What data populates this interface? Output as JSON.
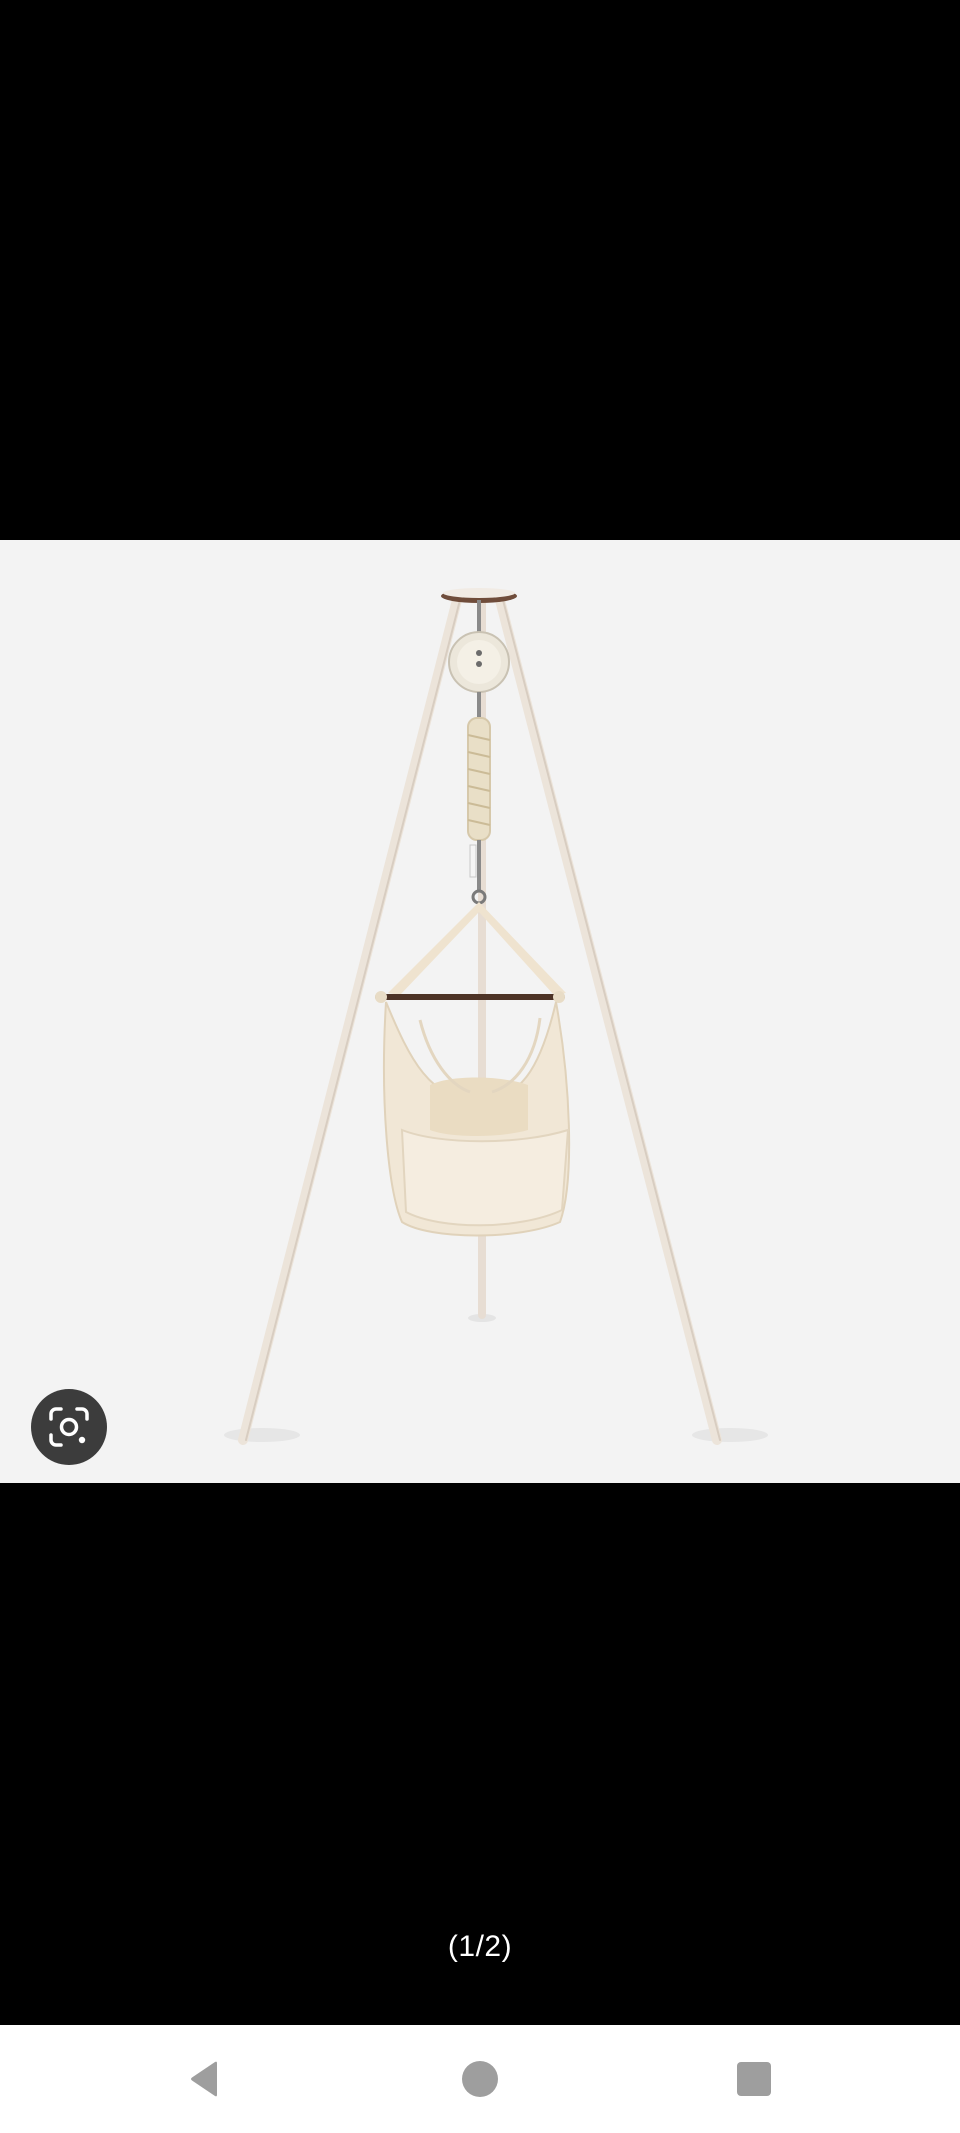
{
  "viewer": {
    "counter": "(1/2)",
    "background": "#000000",
    "photo_background": "#f3f3f3"
  },
  "lens_button": {
    "icon": "google-lens-icon"
  },
  "navbar": {
    "back_icon": "triangle-back-icon",
    "home_icon": "circle-home-icon",
    "recents_icon": "square-recents-icon",
    "icon_color": "#9e9e9e"
  }
}
